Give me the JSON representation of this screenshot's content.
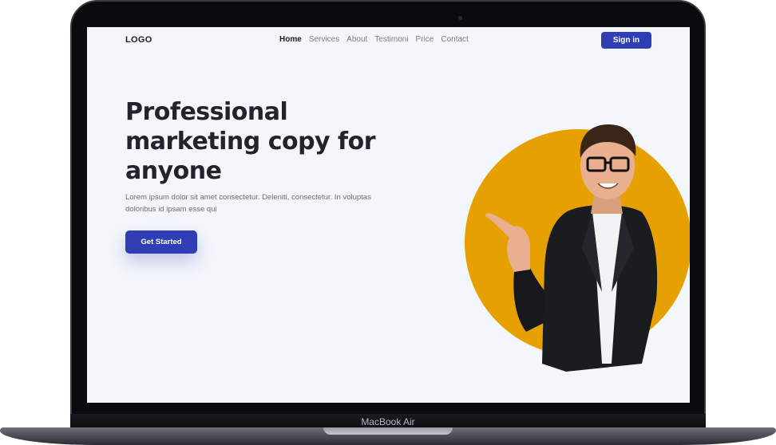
{
  "device": {
    "label": "MacBook Air"
  },
  "nav": {
    "logo": "LOGO",
    "links": [
      "Home",
      "Services",
      "About",
      "Testimoni",
      "Price",
      "Contact"
    ],
    "active": "Home",
    "signin_label": "Sign in"
  },
  "hero": {
    "title": "Professional marketing copy for anyone",
    "description": "Lorem ipsum dolor sit amet consectetur. Deleniti, consectetur. In voluptas doloribus id ipsam esse qui",
    "cta_label": "Get Started"
  },
  "colors": {
    "primary": "#2f3eb5",
    "accent": "#e6a100",
    "background": "#f3f6fb",
    "heading": "#22242c"
  },
  "illustration": {
    "subject": "smiling-man-pointing-icon"
  }
}
